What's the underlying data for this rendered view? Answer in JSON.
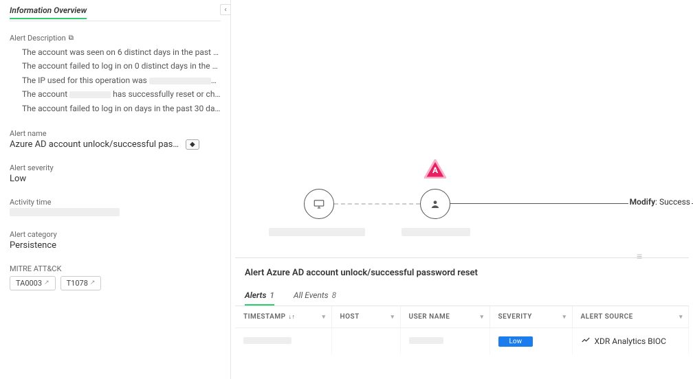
{
  "sidebar": {
    "section_title": "Information Overview",
    "alert_description": {
      "label": "Alert Description",
      "items": [
        "The account was seen on 6 distinct days in the past 30 …",
        "The account failed to log in on 0 distinct days in the pas…",
        "The IP used for this operation was ……",
        "The account …… has successfully reset or cha…",
        "The account failed to log in on   days in the past 30 days"
      ]
    },
    "alert_name": {
      "label": "Alert name",
      "value": "Azure AD account unlock/successful password…"
    },
    "alert_severity": {
      "label": "Alert severity",
      "value": "Low"
    },
    "activity_time": {
      "label": "Activity time",
      "value": ""
    },
    "alert_category": {
      "label": "Alert category",
      "value": "Persistence"
    },
    "mitre": {
      "label": "MITRE ATT&CK",
      "tags": [
        "TA0003",
        "T1078"
      ]
    }
  },
  "graph": {
    "alert_badge": "A",
    "edge_label_key": "Modify",
    "edge_label_val": "Success"
  },
  "detail": {
    "title": "Alert Azure AD account unlock/successful password reset",
    "tabs": [
      {
        "label": "Alerts",
        "count": "1",
        "active": true
      },
      {
        "label": "All Events",
        "count": "8",
        "active": false
      }
    ],
    "columns": [
      "TIMESTAMP",
      "HOST",
      "USER NAME",
      "SEVERITY",
      "ALERT SOURCE"
    ],
    "rows": [
      {
        "timestamp": "",
        "host": "",
        "user_name": "",
        "severity": "Low",
        "source": "XDR Analytics BIOC"
      }
    ]
  }
}
